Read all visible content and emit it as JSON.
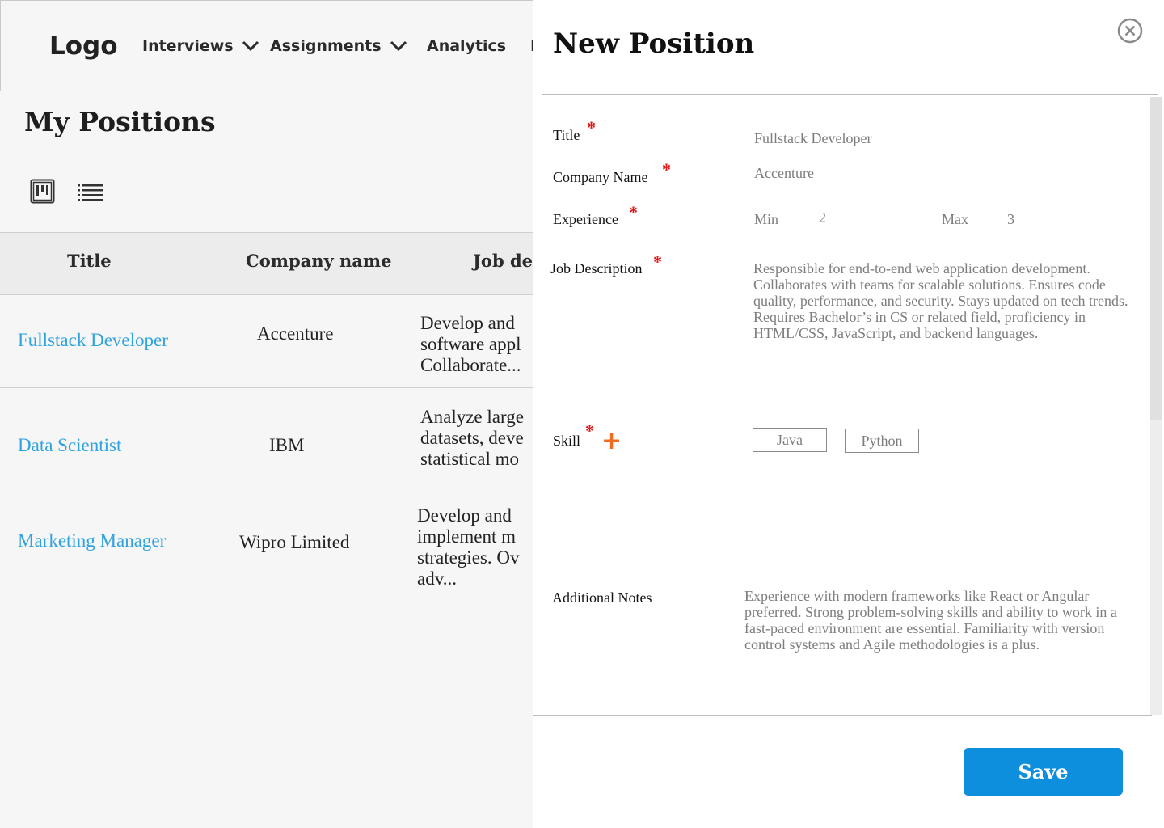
{
  "nav": {
    "logo": "Logo",
    "items": [
      {
        "label": "Interviews",
        "has_dropdown": true
      },
      {
        "label": "Assignments",
        "has_dropdown": true
      },
      {
        "label": "Analytics",
        "has_dropdown": false
      },
      {
        "label": "I",
        "has_dropdown": false
      }
    ]
  },
  "page": {
    "title": "My Positions",
    "view_icons": [
      "board-view-icon",
      "list-view-icon"
    ]
  },
  "table": {
    "columns": [
      "Title",
      "Company name",
      "Job des"
    ],
    "rows": [
      {
        "title": "Fullstack Developer",
        "company": "Accenture",
        "description": "Develop and\nsoftware appl\nCollaborate..."
      },
      {
        "title": "Data Scientist",
        "company": "IBM",
        "description": "Analyze large\ndatasets, deve\nstatistical mo"
      },
      {
        "title": "Marketing Manager",
        "company": "Wipro Limited",
        "description": "Develop and\nimplement m\nstrategies. Ov\nadv..."
      }
    ]
  },
  "drawer": {
    "title": "New Position",
    "close_icon": "close-circle-icon",
    "fields": {
      "title": {
        "label": "Title",
        "required": true,
        "value": "Fullstack Developer"
      },
      "company": {
        "label": "Company Name",
        "required": true,
        "value": "Accenture"
      },
      "experience": {
        "label": "Experience",
        "required": true,
        "min_label": "Min",
        "min_value": "2",
        "max_label": "Max",
        "max_value": "3"
      },
      "description": {
        "label": "Job Description",
        "required": true,
        "value": "Responsible for end-to-end web application development. Collaborates with teams for scalable solutions. Ensures code quality, performance, and security. Stays updated on tech trends. Requires Bachelor’s in CS or related field, proficiency in HTML/CSS, JavaScript, and backend languages."
      },
      "skill": {
        "label": "Skill",
        "required": true,
        "add_icon": "plus-icon",
        "add_symbol": "+",
        "chips": [
          "Java",
          "Python"
        ]
      },
      "notes": {
        "label": "Additional Notes",
        "required": false,
        "value": "Experience with modern frameworks like React or Angular preferred. Strong problem-solving skills and ability to work in a fast-paced environment are essential. Familiarity with version control systems and Agile methodologies is a plus."
      }
    },
    "required_marker": "*",
    "save_label": "Save"
  },
  "colors": {
    "link": "#2ea3df",
    "required": "#e01515",
    "plus": "#ef6d22",
    "save_button": "#0e8fde",
    "background": "#f6f6f6"
  }
}
